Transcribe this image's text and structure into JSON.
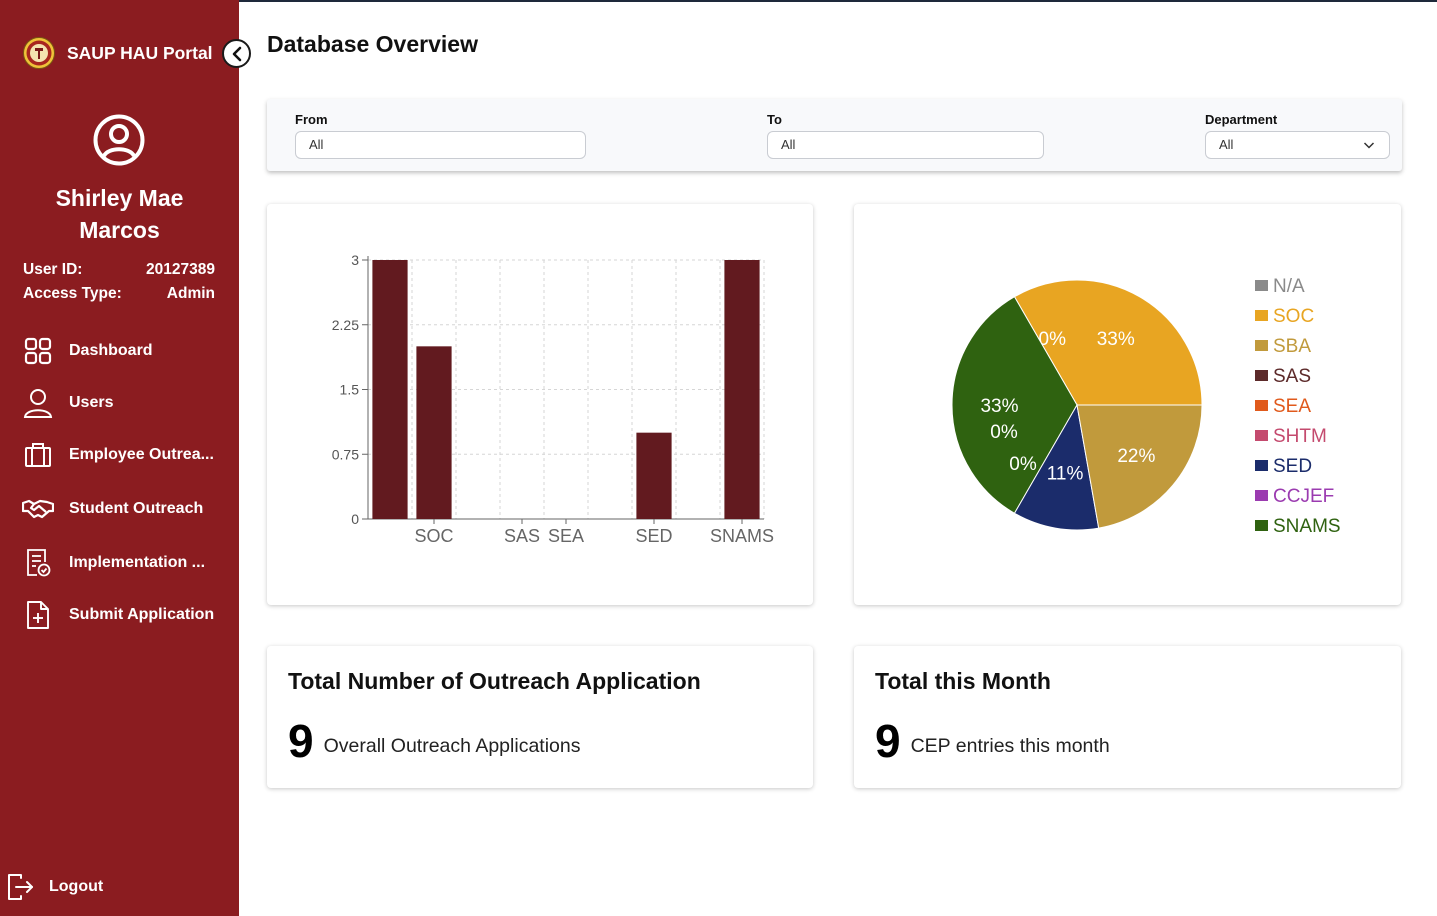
{
  "app": {
    "title": "SAUP HAU Portal"
  },
  "user": {
    "name_line1": "Shirley Mae",
    "name_line2": "Marcos",
    "user_id_label": "User ID:",
    "user_id": "20127389",
    "access_label": "Access Type:",
    "access_type": "Admin"
  },
  "nav": {
    "items": [
      {
        "label": "Dashboard",
        "icon": "grid-icon"
      },
      {
        "label": "Users",
        "icon": "user-icon"
      },
      {
        "label": "Employee Outrea...",
        "icon": "briefcase-icon"
      },
      {
        "label": "Student Outreach",
        "icon": "handshake-icon"
      },
      {
        "label": "Implementation ...",
        "icon": "checklist-icon"
      },
      {
        "label": "Submit Application",
        "icon": "file-plus-icon"
      }
    ],
    "logout_label": "Logout"
  },
  "page": {
    "title": "Database Overview"
  },
  "filters": {
    "from_label": "From",
    "from_value": "All",
    "to_label": "To",
    "to_value": "All",
    "department_label": "Department",
    "department_value": "All"
  },
  "colors": {
    "sidebar": "#8b1c20",
    "bar": "#621a1f"
  },
  "stats": {
    "total": {
      "title": "Total Number of Outreach Application",
      "value": "9",
      "label": "Overall Outreach Applications"
    },
    "month": {
      "title": "Total this Month",
      "value": "9",
      "label": "CEP entries this month"
    }
  },
  "chart_data": [
    {
      "type": "bar",
      "categories": [
        "N/A",
        "SOC",
        "SBA",
        "SAS",
        "SEA",
        "SHTM",
        "SED",
        "CCJEF",
        "SNAMS"
      ],
      "tick_labels": [
        "SOC",
        "SAS",
        "SEA",
        "SED",
        "SNAMS"
      ],
      "values": [
        3,
        2,
        0,
        0,
        0,
        0,
        1,
        0,
        3
      ],
      "ylim": [
        0,
        3
      ],
      "yticks": [
        0,
        0.75,
        1.5,
        2.25,
        3
      ],
      "grid": true,
      "color": "#621a1f"
    },
    {
      "type": "pie",
      "labels": [
        "N/A",
        "SOC",
        "SBA",
        "SAS",
        "SEA",
        "SHTM",
        "SED",
        "CCJEF",
        "SNAMS"
      ],
      "values": [
        0,
        33,
        0,
        0,
        0,
        0,
        33,
        11,
        22
      ],
      "slices": [
        {
          "label": "N/A",
          "value": 0,
          "text": "",
          "color": "#8a8a8a"
        },
        {
          "label": "SOC",
          "value": 33,
          "text": "33%",
          "color": "#e8a522"
        },
        {
          "label": "SBA",
          "value": 0,
          "text": "0%",
          "color": "#c19a3c"
        },
        {
          "label": "SAS",
          "value": 0,
          "text": "",
          "color": "#5c2a2a"
        },
        {
          "label": "SEA",
          "value": 0,
          "text": "",
          "color": "#e05a1c"
        },
        {
          "label": "SHTM",
          "value": 0,
          "text": "",
          "color": "#c44a6e"
        },
        {
          "label": "SED",
          "value": 33,
          "text": "33%",
          "color": "#2f6210"
        },
        {
          "label": "CCJEF",
          "value": 11,
          "text": "11%",
          "color": "#1b2c6b"
        },
        {
          "label": "SNAMS",
          "value": 22,
          "text": "22%",
          "color": "#c19a3c"
        }
      ],
      "extra_labels": [
        "0%",
        "0%"
      ],
      "legend": [
        {
          "label": "N/A",
          "color": "#8a8a8a"
        },
        {
          "label": "SOC",
          "color": "#e8a522"
        },
        {
          "label": "SBA",
          "color": "#c19a3c"
        },
        {
          "label": "SAS",
          "color": "#5c2a2a"
        },
        {
          "label": "SEA",
          "color": "#e05a1c"
        },
        {
          "label": "SHTM",
          "color": "#c44a6e"
        },
        {
          "label": "SED",
          "color": "#1b2c6b"
        },
        {
          "label": "CCJEF",
          "color": "#9b3bb0"
        },
        {
          "label": "SNAMS",
          "color": "#2f6210"
        }
      ],
      "legend_position": "right"
    }
  ]
}
